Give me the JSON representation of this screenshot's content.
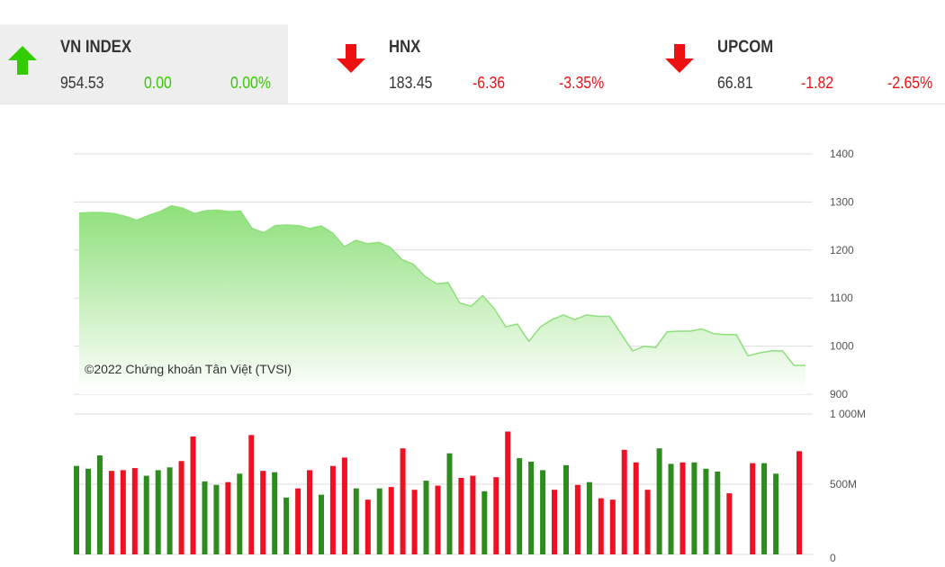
{
  "indices": [
    {
      "name": "VN INDEX",
      "value": "954.53",
      "change": "0.00",
      "percent": "0.00%",
      "direction": "up",
      "icon": "arrow-up-icon"
    },
    {
      "name": "HNX",
      "value": "183.45",
      "change": "-6.36",
      "percent": "-3.35%",
      "direction": "down",
      "icon": "arrow-down-icon"
    },
    {
      "name": "UPCOM",
      "value": "66.81",
      "change": "-1.82",
      "percent": "-2.65%",
      "direction": "down",
      "icon": "arrow-down-icon"
    }
  ],
  "colors": {
    "up": "#33cc00",
    "down": "#ee1111",
    "bar_up": "#2e8b1e",
    "bar_down": "#ee1122",
    "area_line": "#8ee07a"
  },
  "chart_data": [
    {
      "type": "area",
      "y_ticks": [
        "1400",
        "1300",
        "1200",
        "1100",
        "1000",
        "900"
      ],
      "ylim": [
        900,
        1400
      ],
      "grid": true,
      "annotation": "©2022 Chứng khoán Tân Việt (TVSI)",
      "values": [
        1277,
        1278,
        1278,
        1276,
        1270,
        1262,
        1272,
        1280,
        1292,
        1287,
        1276,
        1282,
        1283,
        1280,
        1281,
        1245,
        1236,
        1251,
        1252,
        1251,
        1245,
        1250,
        1235,
        1207,
        1220,
        1213,
        1216,
        1205,
        1180,
        1170,
        1145,
        1130,
        1132,
        1090,
        1083,
        1105,
        1078,
        1040,
        1046,
        1010,
        1040,
        1055,
        1065,
        1055,
        1065,
        1062,
        1062,
        1026,
        990,
        1000,
        997,
        1030,
        1031,
        1031,
        1036,
        1026,
        1024,
        1024,
        980,
        986,
        990,
        990,
        960,
        960
      ]
    },
    {
      "type": "bar",
      "y_ticks": [
        "1 000M",
        "500M",
        "0"
      ],
      "ylim": [
        0,
        1000
      ],
      "values": [
        630,
        610,
        705,
        595,
        600,
        615,
        560,
        600,
        620,
        665,
        840,
        520,
        495,
        515,
        575,
        850,
        595,
        585,
        405,
        470,
        600,
        425,
        630,
        690,
        470,
        390,
        470,
        480,
        755,
        460,
        525,
        490,
        720,
        545,
        560,
        450,
        550,
        875,
        685,
        660,
        600,
        460,
        635,
        495,
        515,
        400,
        390,
        745,
        655,
        460,
        755,
        645,
        655,
        655,
        610,
        590,
        435,
        0,
        650,
        650,
        575,
        0,
        735
      ],
      "up": [
        1,
        1,
        1,
        0,
        0,
        0,
        1,
        1,
        1,
        0,
        0,
        1,
        1,
        0,
        1,
        0,
        0,
        1,
        1,
        0,
        0,
        1,
        0,
        0,
        1,
        0,
        1,
        0,
        0,
        0,
        1,
        0,
        1,
        0,
        0,
        1,
        0,
        0,
        1,
        1,
        1,
        0,
        1,
        0,
        1,
        0,
        0,
        0,
        0,
        0,
        1,
        1,
        0,
        1,
        1,
        1,
        0,
        0,
        0,
        1,
        1,
        0,
        0
      ]
    }
  ]
}
